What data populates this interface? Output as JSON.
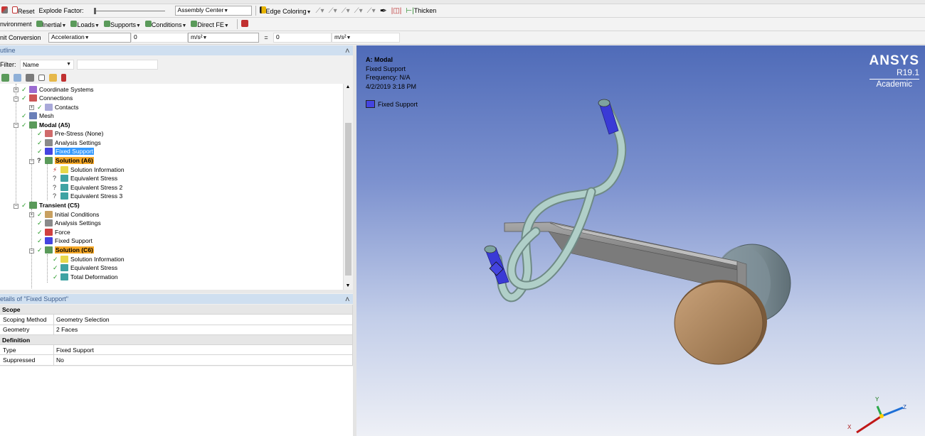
{
  "toolbar1": {
    "reset_label": "Reset",
    "explode_label": "Explode Factor:",
    "assembly_center": "Assembly Center",
    "edge_coloring": "Edge Coloring",
    "thicken": "Thicken"
  },
  "toolbar2": {
    "environment": "nvironment",
    "inertial": "Inertial",
    "loads": "Loads",
    "supports": "Supports",
    "conditions": "Conditions",
    "direct_fe": "Direct FE"
  },
  "toolbar3": {
    "unit_conversion": "nit Conversion",
    "quantity": "Acceleration",
    "value1": "0",
    "unit1": "m/s²",
    "equals": "=",
    "value2": "0",
    "unit2": "m/s²"
  },
  "outline": {
    "title": "utline",
    "filter_label": "Filter:",
    "filter_value": "Name",
    "tree": [
      {
        "label": "Coordinate Systems"
      },
      {
        "label": "Connections"
      },
      {
        "label": "Contacts"
      },
      {
        "label": "Mesh"
      },
      {
        "label": "Modal (A5)"
      },
      {
        "label": "Pre-Stress (None)"
      },
      {
        "label": "Analysis Settings"
      },
      {
        "label": "Fixed Support"
      },
      {
        "label": "Solution (A6)"
      },
      {
        "label": "Solution Information"
      },
      {
        "label": "Equivalent Stress"
      },
      {
        "label": "Equivalent Stress 2"
      },
      {
        "label": "Equivalent Stress 3"
      },
      {
        "label": "Transient (C5)"
      },
      {
        "label": "Initial Conditions"
      },
      {
        "label": "Analysis Settings"
      },
      {
        "label": "Force"
      },
      {
        "label": "Fixed Support"
      },
      {
        "label": "Solution (C6)"
      },
      {
        "label": "Solution Information"
      },
      {
        "label": "Equivalent Stress"
      },
      {
        "label": "Total Deformation"
      }
    ]
  },
  "details": {
    "title": "etails of \"Fixed Support\"",
    "scope": "Scope",
    "scoping_method_k": "Scoping Method",
    "scoping_method_v": "Geometry Selection",
    "geometry_k": "Geometry",
    "geometry_v": "2 Faces",
    "definition": "Definition",
    "type_k": "Type",
    "type_v": "Fixed Support",
    "suppressed_k": "Suppressed",
    "suppressed_v": "No"
  },
  "viewport": {
    "info_title": "A: Modal",
    "info_line1": "Fixed Support",
    "info_line2": "Frequency: N/A",
    "info_line3": "4/2/2019 3:18 PM",
    "legend_label": "Fixed Support",
    "brand_name": "ANSYS",
    "brand_version": "R19.1",
    "brand_edition": "Academic",
    "axis_x": "X",
    "axis_y": "Y",
    "axis_z": "Z"
  },
  "colors": {
    "highlight_blue": "#3399ff",
    "highlight_orange": "#f7a928",
    "support_blue": "#4444e0",
    "tube": "#a9c7c0",
    "wheel_tan": "#b08a5d",
    "wheel_gray": "#7f9098"
  }
}
